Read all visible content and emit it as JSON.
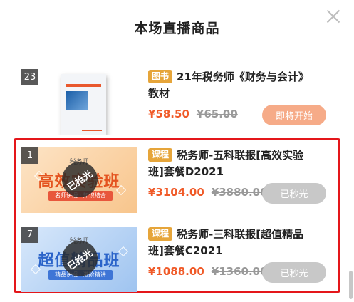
{
  "panel": {
    "title": "本场直播商品"
  },
  "icons": {
    "close": "close-icon",
    "stamp": "sold-out-stamp"
  },
  "colors": {
    "price": "#f05a28",
    "tag": "#e6a53a",
    "start_button": "#f6ab88",
    "sold_button": "#c8c8c8",
    "highlight": "#e4161a"
  },
  "items": [
    {
      "index": "23",
      "tag": "图书",
      "name_line1": "21年税务师《财务与会计》",
      "name_line2": "教材",
      "price": "¥58.50",
      "original_price": "¥65.00",
      "button": "即将开始",
      "thumb": {
        "type": "book"
      }
    },
    {
      "index": "1",
      "tag": "课程",
      "name_line1": "税务师-五科联报[高效实验",
      "name_line2": "班]套餐D2021",
      "price": "¥3104.00",
      "original_price": "¥3880.00",
      "button": "已秒光",
      "thumb": {
        "type": "banner",
        "small_text": "税务师",
        "big_text": "高效实验班",
        "strip_text": "名师讲授 · 知识结合",
        "stamp": "已抢光"
      }
    },
    {
      "index": "7",
      "tag": "课程",
      "name_line1": "税务师-三科联报[超值精品",
      "name_line2": "班]套餐C2021",
      "price": "¥1088.00",
      "original_price": "¥1360.00",
      "button": "已秒光",
      "thumb": {
        "type": "banner",
        "small_text": "税务师",
        "big_text": "超值精品班",
        "strip_text": "精品讲授 · 进阶精讲",
        "stamp": "已抢光"
      }
    }
  ]
}
